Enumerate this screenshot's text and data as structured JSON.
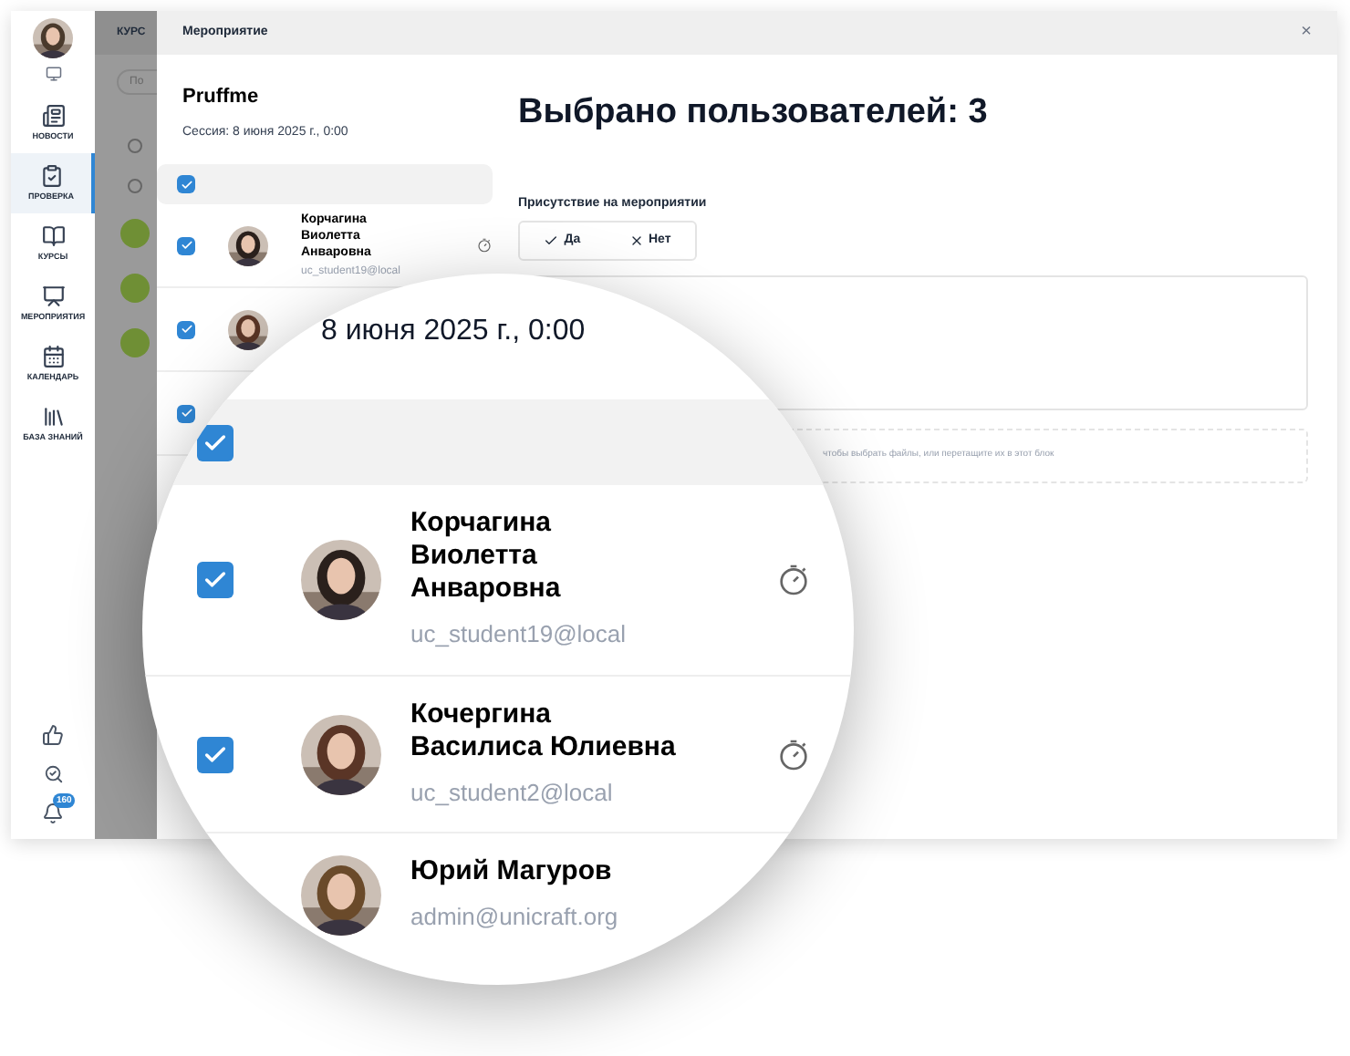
{
  "sidebar": {
    "items": [
      {
        "label": "НОВОСТИ",
        "selected": false
      },
      {
        "label": "ПРОВЕРКА",
        "selected": true
      },
      {
        "label": "КУРСЫ",
        "selected": false
      },
      {
        "label": "МЕРОПРИЯТИЯ",
        "selected": false
      },
      {
        "label": "КАЛЕНДАРЬ",
        "selected": false
      },
      {
        "label": "БАЗА ЗНАНИЙ",
        "selected": false
      }
    ],
    "notification_badge": "160"
  },
  "backdrop": {
    "header": "КУРС",
    "search_placeholder": "По"
  },
  "modal": {
    "title": "Мероприятие",
    "close": "×",
    "event_name": "Pruffme",
    "session": "Сессия: 8 июня 2025 г., 0:00",
    "select_all_checked": true,
    "participants": [
      {
        "name": "Корчагина Виолетта Анваровна",
        "email": "uc_student19@local",
        "checked": true
      },
      {
        "checked": true
      },
      {
        "checked": true
      }
    ],
    "selected_title": "Выбрано пользователей: 3",
    "attendance": {
      "label": "Присутствие на мероприятии",
      "options": [
        {
          "kind": "yes",
          "label": "Да",
          "selected": false
        },
        {
          "kind": "no",
          "label": "Нет",
          "selected": false
        }
      ]
    },
    "dropzone_text": "чтобы выбрать файлы, или перетащите их в этот блок"
  },
  "magnifier": {
    "session_fragment": "8 июня 2025 г., 0:00",
    "select_all_checked": true,
    "participants": [
      {
        "name": "Корчагина Виолетта Анваровна",
        "email": "uc_student19@local",
        "checked": true
      },
      {
        "name": "Кочергина Василиса Юлиевна",
        "email": "uc_student2@local",
        "checked": true
      },
      {
        "name": "Юрий Магуров",
        "email": "admin@unicraft.org"
      }
    ]
  }
}
